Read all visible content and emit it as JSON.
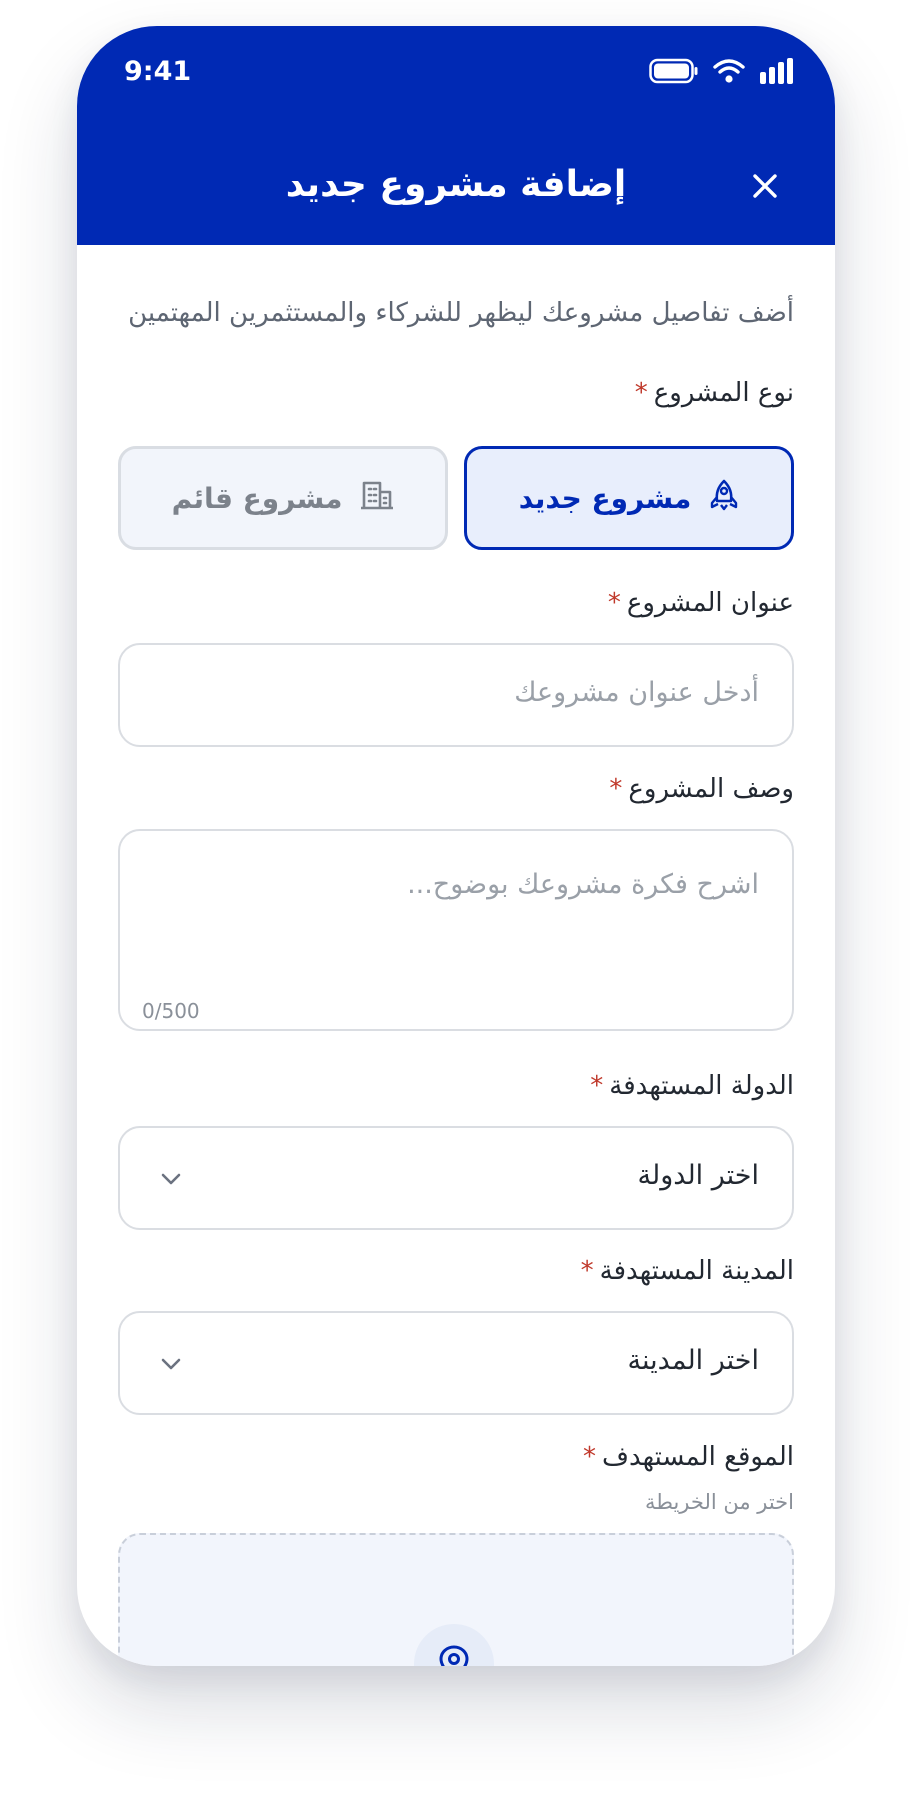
{
  "status_bar": {
    "time": "9:41"
  },
  "header": {
    "title": "إضافة مشروع جديد",
    "close_icon": "close-icon"
  },
  "form": {
    "subtitle": "أضف تفاصيل مشروعك ليظهر للشركاء والمستثمرين المهتمين",
    "required_mark": "*",
    "project_type": {
      "label": "نوع المشروع",
      "options": [
        {
          "label": "مشروع جديد",
          "icon": "rocket-icon",
          "selected": true
        },
        {
          "label": "مشروع قائم",
          "icon": "building-icon",
          "selected": false
        }
      ]
    },
    "title_field": {
      "label": "عنوان المشروع",
      "placeholder": "أدخل عنوان مشروعك"
    },
    "description_field": {
      "label": "وصف المشروع",
      "placeholder": "اشرح فكرة مشروعك بوضوح...",
      "counter": "0/500"
    },
    "country_field": {
      "label": "الدولة المستهدفة",
      "value": "اختر الدولة"
    },
    "city_field": {
      "label": "المدينة المستهدفة",
      "value": "اختر المدينة"
    },
    "location_field": {
      "label": "الموقع المستهدف",
      "hint": "اختر من الخريطة",
      "icon": "map-pin-icon"
    }
  },
  "colors": {
    "primary": "#0029B4",
    "selected_card_bg": "#E8EEFC",
    "required": "#C0392B",
    "map_bg": "#F2F5FC"
  }
}
